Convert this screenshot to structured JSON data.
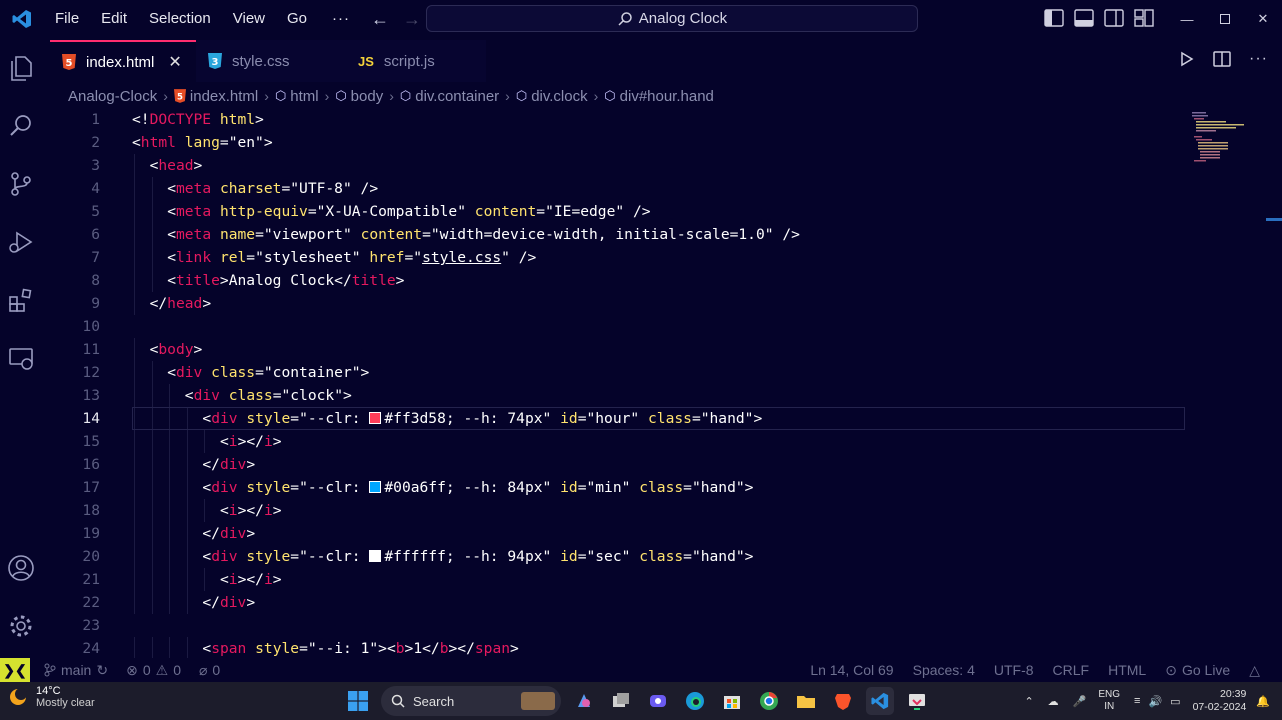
{
  "menu": [
    "File",
    "Edit",
    "Selection",
    "View",
    "Go"
  ],
  "menu_more": "···",
  "command_center": "Analog Clock",
  "tabs": [
    {
      "icon": "html5-icon",
      "label": "index.html",
      "active": true
    },
    {
      "icon": "css3-icon",
      "label": "style.css",
      "active": false
    },
    {
      "icon": "js-icon",
      "icon_text": "JS",
      "label": "script.js",
      "active": false
    }
  ],
  "breadcrumb": [
    "Analog-Clock",
    "index.html",
    "html",
    "body",
    "div.container",
    "div.clock",
    "div#hour.hand"
  ],
  "code": {
    "current_line": 14,
    "lines": [
      {
        "n": 1,
        "indent": 0,
        "parts": [
          [
            "p",
            "<!"
          ],
          [
            "tag",
            "DOCTYPE"
          ],
          [
            "p",
            " "
          ],
          [
            "attr",
            "html"
          ],
          [
            "p",
            ">"
          ]
        ]
      },
      {
        "n": 2,
        "indent": 0,
        "parts": [
          [
            "p",
            "<"
          ],
          [
            "tag",
            "html"
          ],
          [
            "p",
            " "
          ],
          [
            "attr",
            "lang"
          ],
          [
            "p",
            "="
          ],
          [
            "str",
            "\"en\""
          ],
          [
            "p",
            ">"
          ]
        ]
      },
      {
        "n": 3,
        "indent": 1,
        "parts": [
          [
            "p",
            "<"
          ],
          [
            "tag",
            "head"
          ],
          [
            "p",
            ">"
          ]
        ]
      },
      {
        "n": 4,
        "indent": 2,
        "parts": [
          [
            "p",
            "<"
          ],
          [
            "tag",
            "meta"
          ],
          [
            "p",
            " "
          ],
          [
            "attr",
            "charset"
          ],
          [
            "p",
            "="
          ],
          [
            "str",
            "\"UTF-8\""
          ],
          [
            "p",
            " />"
          ]
        ]
      },
      {
        "n": 5,
        "indent": 2,
        "parts": [
          [
            "p",
            "<"
          ],
          [
            "tag",
            "meta"
          ],
          [
            "p",
            " "
          ],
          [
            "attr",
            "http-equiv"
          ],
          [
            "p",
            "="
          ],
          [
            "str",
            "\"X-UA-Compatible\""
          ],
          [
            "p",
            " "
          ],
          [
            "attr",
            "content"
          ],
          [
            "p",
            "="
          ],
          [
            "str",
            "\"IE=edge\""
          ],
          [
            "p",
            " />"
          ]
        ]
      },
      {
        "n": 6,
        "indent": 2,
        "parts": [
          [
            "p",
            "<"
          ],
          [
            "tag",
            "meta"
          ],
          [
            "p",
            " "
          ],
          [
            "attr",
            "name"
          ],
          [
            "p",
            "="
          ],
          [
            "str",
            "\"viewport\""
          ],
          [
            "p",
            " "
          ],
          [
            "attr",
            "content"
          ],
          [
            "p",
            "="
          ],
          [
            "str",
            "\"width=device-width, initial-scale=1.0\""
          ],
          [
            "p",
            " />"
          ]
        ]
      },
      {
        "n": 7,
        "indent": 2,
        "parts": [
          [
            "p",
            "<"
          ],
          [
            "tag",
            "link"
          ],
          [
            "p",
            " "
          ],
          [
            "attr",
            "rel"
          ],
          [
            "p",
            "="
          ],
          [
            "str",
            "\"stylesheet\""
          ],
          [
            "p",
            " "
          ],
          [
            "attr",
            "href"
          ],
          [
            "p",
            "="
          ],
          [
            "str",
            "\""
          ],
          [
            "link",
            "style.css"
          ],
          [
            "str",
            "\""
          ],
          [
            "p",
            " />"
          ]
        ]
      },
      {
        "n": 8,
        "indent": 2,
        "parts": [
          [
            "p",
            "<"
          ],
          [
            "tag",
            "title"
          ],
          [
            "p",
            ">"
          ],
          [
            "text",
            "Analog Clock"
          ],
          [
            "p",
            "</"
          ],
          [
            "tag",
            "title"
          ],
          [
            "p",
            ">"
          ]
        ]
      },
      {
        "n": 9,
        "indent": 1,
        "parts": [
          [
            "p",
            "</"
          ],
          [
            "tag",
            "head"
          ],
          [
            "p",
            ">"
          ]
        ]
      },
      {
        "n": 10,
        "indent": 0,
        "parts": []
      },
      {
        "n": 11,
        "indent": 1,
        "parts": [
          [
            "p",
            "<"
          ],
          [
            "tag",
            "body"
          ],
          [
            "p",
            ">"
          ]
        ]
      },
      {
        "n": 12,
        "indent": 2,
        "parts": [
          [
            "p",
            "<"
          ],
          [
            "tag",
            "div"
          ],
          [
            "p",
            " "
          ],
          [
            "attr",
            "class"
          ],
          [
            "p",
            "="
          ],
          [
            "str",
            "\"container\""
          ],
          [
            "p",
            ">"
          ]
        ]
      },
      {
        "n": 13,
        "indent": 3,
        "parts": [
          [
            "p",
            "<"
          ],
          [
            "tag",
            "div"
          ],
          [
            "p",
            " "
          ],
          [
            "attr",
            "class"
          ],
          [
            "p",
            "="
          ],
          [
            "str",
            "\"clock\""
          ],
          [
            "p",
            ">"
          ]
        ]
      },
      {
        "n": 14,
        "indent": 4,
        "parts": [
          [
            "p",
            "<"
          ],
          [
            "tag",
            "div"
          ],
          [
            "p",
            " "
          ],
          [
            "attr",
            "style"
          ],
          [
            "p",
            "="
          ],
          [
            "str",
            "\"--clr: "
          ],
          [
            "swatch",
            "#ff3d58"
          ],
          [
            "str",
            "#ff3d58; --h: 74px\""
          ],
          [
            "p",
            " "
          ],
          [
            "attr",
            "id"
          ],
          [
            "p",
            "="
          ],
          [
            "str",
            "\"hour\""
          ],
          [
            "p",
            " "
          ],
          [
            "attr",
            "class"
          ],
          [
            "p",
            "="
          ],
          [
            "str",
            "\"hand\""
          ],
          [
            "p",
            ">"
          ]
        ]
      },
      {
        "n": 15,
        "indent": 5,
        "parts": [
          [
            "p",
            "<"
          ],
          [
            "tag",
            "i"
          ],
          [
            "p",
            "></"
          ],
          [
            "tag",
            "i"
          ],
          [
            "p",
            ">"
          ]
        ]
      },
      {
        "n": 16,
        "indent": 4,
        "parts": [
          [
            "p",
            "</"
          ],
          [
            "tag",
            "div"
          ],
          [
            "p",
            ">"
          ]
        ]
      },
      {
        "n": 17,
        "indent": 4,
        "parts": [
          [
            "p",
            "<"
          ],
          [
            "tag",
            "div"
          ],
          [
            "p",
            " "
          ],
          [
            "attr",
            "style"
          ],
          [
            "p",
            "="
          ],
          [
            "str",
            "\"--clr: "
          ],
          [
            "swatch",
            "#00a6ff"
          ],
          [
            "str",
            "#00a6ff; --h: 84px\""
          ],
          [
            "p",
            " "
          ],
          [
            "attr",
            "id"
          ],
          [
            "p",
            "="
          ],
          [
            "str",
            "\"min\""
          ],
          [
            "p",
            " "
          ],
          [
            "attr",
            "class"
          ],
          [
            "p",
            "="
          ],
          [
            "str",
            "\"hand\""
          ],
          [
            "p",
            ">"
          ]
        ]
      },
      {
        "n": 18,
        "indent": 5,
        "parts": [
          [
            "p",
            "<"
          ],
          [
            "tag",
            "i"
          ],
          [
            "p",
            "></"
          ],
          [
            "tag",
            "i"
          ],
          [
            "p",
            ">"
          ]
        ]
      },
      {
        "n": 19,
        "indent": 4,
        "parts": [
          [
            "p",
            "</"
          ],
          [
            "tag",
            "div"
          ],
          [
            "p",
            ">"
          ]
        ]
      },
      {
        "n": 20,
        "indent": 4,
        "parts": [
          [
            "p",
            "<"
          ],
          [
            "tag",
            "div"
          ],
          [
            "p",
            " "
          ],
          [
            "attr",
            "style"
          ],
          [
            "p",
            "="
          ],
          [
            "str",
            "\"--clr: "
          ],
          [
            "swatch",
            "#ffffff"
          ],
          [
            "str",
            "#ffffff; --h: 94px\""
          ],
          [
            "p",
            " "
          ],
          [
            "attr",
            "id"
          ],
          [
            "p",
            "="
          ],
          [
            "str",
            "\"sec\""
          ],
          [
            "p",
            " "
          ],
          [
            "attr",
            "class"
          ],
          [
            "p",
            "="
          ],
          [
            "str",
            "\"hand\""
          ],
          [
            "p",
            ">"
          ]
        ]
      },
      {
        "n": 21,
        "indent": 5,
        "parts": [
          [
            "p",
            "<"
          ],
          [
            "tag",
            "i"
          ],
          [
            "p",
            "></"
          ],
          [
            "tag",
            "i"
          ],
          [
            "p",
            ">"
          ]
        ]
      },
      {
        "n": 22,
        "indent": 4,
        "parts": [
          [
            "p",
            "</"
          ],
          [
            "tag",
            "div"
          ],
          [
            "p",
            ">"
          ]
        ]
      },
      {
        "n": 23,
        "indent": 0,
        "parts": []
      },
      {
        "n": 24,
        "indent": 4,
        "parts": [
          [
            "p",
            "<"
          ],
          [
            "tag",
            "span"
          ],
          [
            "p",
            " "
          ],
          [
            "attr",
            "style"
          ],
          [
            "p",
            "="
          ],
          [
            "str",
            "\"--i: 1\""
          ],
          [
            "p",
            "><"
          ],
          [
            "tag",
            "b"
          ],
          [
            "p",
            ">"
          ],
          [
            "text",
            "1"
          ],
          [
            "p",
            "</"
          ],
          [
            "tag",
            "b"
          ],
          [
            "p",
            "></"
          ],
          [
            "tag",
            "span"
          ],
          [
            "p",
            ">"
          ]
        ]
      }
    ]
  },
  "status": {
    "remote_icon": "remote-icon",
    "branch": "main",
    "errors": "0",
    "warnings": "0",
    "ports": "0",
    "position": "Ln 14, Col 69",
    "spaces": "Spaces: 4",
    "encoding": "UTF-8",
    "eol": "CRLF",
    "language": "HTML",
    "golive": "Go Live"
  },
  "taskbar": {
    "temperature": "14°C",
    "condition": "Mostly clear",
    "search": "Search",
    "lang_top": "ENG",
    "lang_bottom": "IN",
    "time": "20:39",
    "date": "07-02-2024"
  },
  "colors": {
    "background": "#05032a",
    "accent": "#ff2d6f",
    "tag": "#e5195f",
    "attribute": "#ffe36e",
    "string": "#ffffff",
    "remote": "#d5e22f"
  }
}
